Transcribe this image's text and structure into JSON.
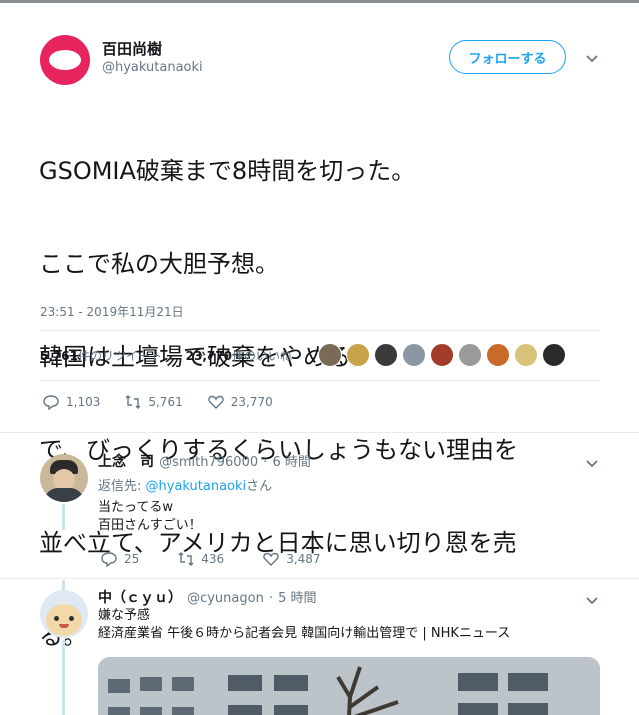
{
  "tweet": {
    "display_name": "百田尚樹",
    "handle": "@hyakutanaoki",
    "follow_label": "フォローする",
    "lines": [
      "GSOMIA破棄まで8時間を切った。",
      "ここで私の大胆予想。",
      "韓国は土壇場で破棄をやめる。",
      "で、びっくりするくらいしょうもない理由を",
      "並べ立て、アメリカと日本に思い切り恩を売",
      "る。"
    ],
    "timestamp": "23:51 - 2019年11月21日",
    "retweets_count": "5,761",
    "retweets_label": "件のリツイート",
    "likes_count": "23,770",
    "likes_label": "件のいいね",
    "actions": {
      "replies": "1,103",
      "retweets": "5,761",
      "likes": "23,770"
    }
  },
  "likers_faces": [
    "#7a6a55",
    "#c9a24a",
    "#3a3a3a",
    "#8b97a3",
    "#a33a2a",
    "#9a9a9a",
    "#c76a2a",
    "#d9c27a",
    "#2a2a2a"
  ],
  "replies": [
    {
      "display_name": "上念　司",
      "handle": "@smith796000",
      "time": "6 時間",
      "reply_prefix": "返信先: ",
      "reply_mention": "@hyakutanaoki",
      "reply_suffix": "さん",
      "body": [
        "当たってるw",
        "百田さんすごい！"
      ],
      "actions": {
        "replies": "25",
        "retweets": "436",
        "likes": "3,487"
      }
    },
    {
      "display_name": "中（ｃｙｕ）",
      "handle": "@cyunagon",
      "time": "5 時間",
      "body": [
        "嫌な予感",
        "経済産業省 午後６時から記者会見 韓国向け輸出管理で | NHKニュース"
      ]
    }
  ],
  "separator": "·",
  "colors": {
    "accent": "#1da1f2",
    "brand_avatar": "#e8245e",
    "text": "#14171a",
    "muted": "#657786"
  }
}
